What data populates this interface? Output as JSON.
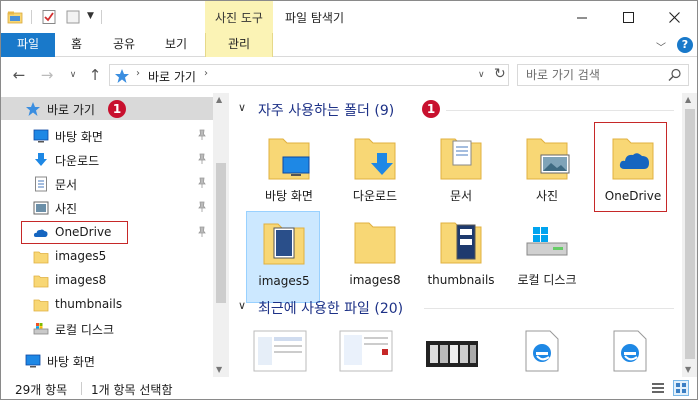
{
  "title_bar": {
    "context_tab": "사진 도구",
    "app_title": "파일 탐색기"
  },
  "ribbon": {
    "file": "파일",
    "home": "홈",
    "share": "공유",
    "view": "보기",
    "manage": "관리",
    "help": "?"
  },
  "address": {
    "path": "바로 가기",
    "search_placeholder": "바로 가기 검색"
  },
  "nav_pane": {
    "items": [
      {
        "label": "바로 가기",
        "icon": "star-icon"
      },
      {
        "label": "바탕 화면",
        "icon": "desktop-icon",
        "pinned": true
      },
      {
        "label": "다운로드",
        "icon": "download-icon",
        "pinned": true
      },
      {
        "label": "문서",
        "icon": "document-icon",
        "pinned": true
      },
      {
        "label": "사진",
        "icon": "picture-icon",
        "pinned": true
      },
      {
        "label": "OneDrive",
        "icon": "cloud-icon",
        "pinned": true
      },
      {
        "label": "images5",
        "icon": "folder-icon"
      },
      {
        "label": "images8",
        "icon": "folder-icon"
      },
      {
        "label": "thumbnails",
        "icon": "folder-icon"
      },
      {
        "label": "로컬 디스크",
        "icon": "drive-icon"
      },
      {
        "label": "바탕 화면",
        "icon": "desktop-icon"
      }
    ],
    "badge": "1"
  },
  "content": {
    "frequent_group": "자주 사용하는 폴더 (9)",
    "recent_group": "최근에 사용한 파일 (20)",
    "badge": "1",
    "tiles": [
      {
        "label": "바탕 화면",
        "icon": "desktop-folder-icon"
      },
      {
        "label": "다운로드",
        "icon": "download-folder-icon"
      },
      {
        "label": "문서",
        "icon": "document-folder-icon"
      },
      {
        "label": "사진",
        "icon": "picture-folder-icon"
      },
      {
        "label": "OneDrive",
        "icon": "onedrive-folder-icon"
      },
      {
        "label": "images5",
        "icon": "folder-icon",
        "selected": true
      },
      {
        "label": "images8",
        "icon": "folder-icon"
      },
      {
        "label": "thumbnails",
        "icon": "folder-icon"
      },
      {
        "label": "로컬 디스크",
        "icon": "drive-icon"
      }
    ]
  },
  "status": {
    "count": "29개 항목",
    "selection": "1개 항목 선택함"
  },
  "colors": {
    "accent": "#1979ca",
    "context_tab": "#fbf3b5",
    "badge": "#c8102e",
    "highlight_box": "#c62828",
    "folder": "#f8d775"
  }
}
